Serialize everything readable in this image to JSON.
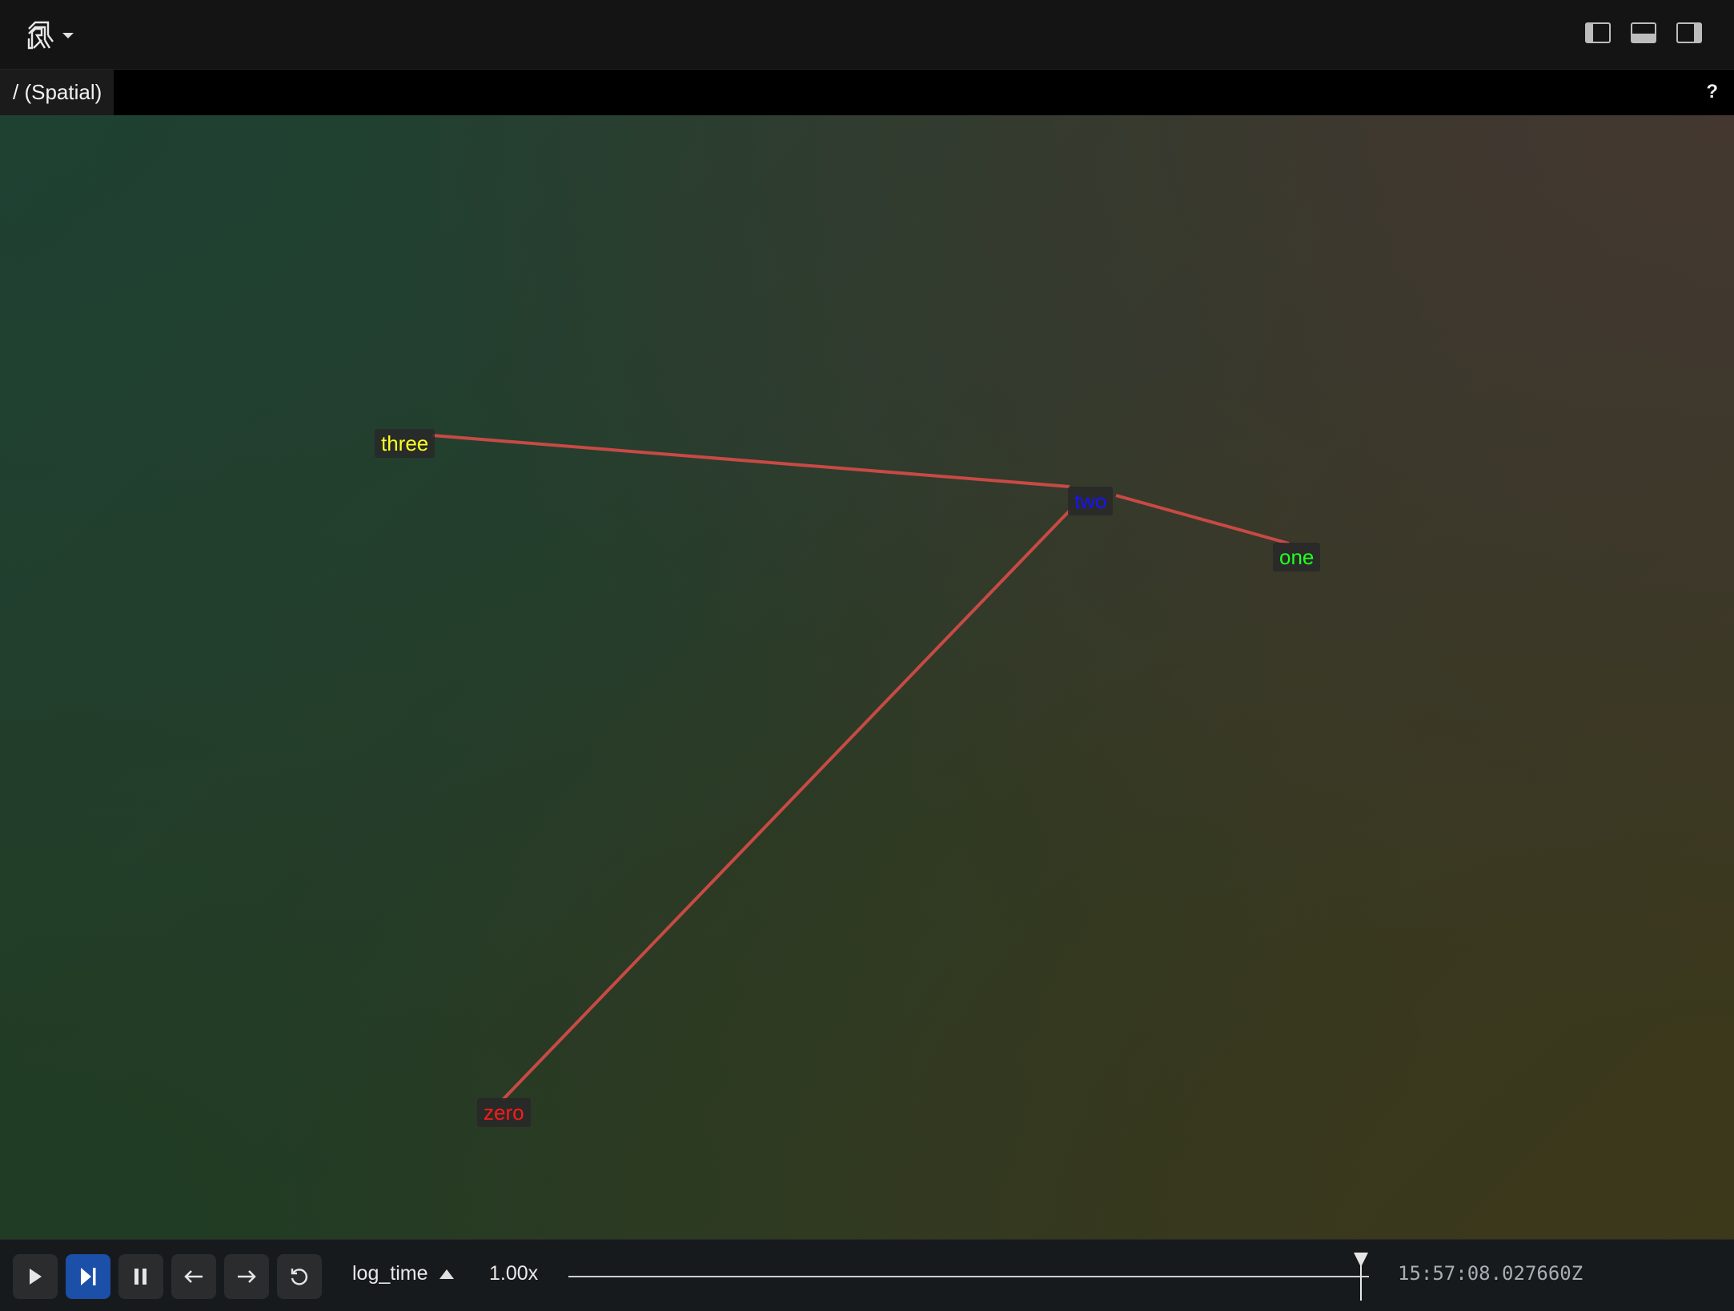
{
  "header": {
    "logo_icon": "rerun-logo-icon",
    "menu_caret_icon": "caret-down-icon",
    "panel_toggles": [
      {
        "name": "toggle-left-panel",
        "icon": "left-panel-icon"
      },
      {
        "name": "toggle-bottom-panel",
        "icon": "bottom-panel-icon"
      },
      {
        "name": "toggle-right-panel",
        "icon": "right-panel-icon"
      }
    ]
  },
  "tabbar": {
    "tab_label": "/ (Spatial)",
    "help_label": "?"
  },
  "viewport": {
    "edge_color": "#c84a45",
    "nodes": [
      {
        "id": "zero",
        "label": "zero",
        "color": "#ff1a1a"
      },
      {
        "id": "one",
        "label": "one",
        "color": "#22ff22"
      },
      {
        "id": "two",
        "label": "two",
        "color": "#1414ff"
      },
      {
        "id": "three",
        "label": "three",
        "color": "#ffff22"
      }
    ],
    "edges": [
      [
        "three",
        "two"
      ],
      [
        "two",
        "one"
      ],
      [
        "two",
        "zero"
      ]
    ]
  },
  "timeline": {
    "controls": [
      {
        "name": "play-button",
        "icon": "play-icon"
      },
      {
        "name": "follow-button",
        "icon": "step-to-end-icon",
        "active": true
      },
      {
        "name": "pause-button",
        "icon": "pause-icon"
      },
      {
        "name": "step-back-button",
        "icon": "arrow-left-icon"
      },
      {
        "name": "step-forward-button",
        "icon": "arrow-right-icon"
      },
      {
        "name": "loop-button",
        "icon": "loop-icon"
      }
    ],
    "timeline_name": "log_time",
    "speed": "1.00x",
    "playhead_fraction": 0.99,
    "current_time": "15:57:08.027660Z"
  }
}
